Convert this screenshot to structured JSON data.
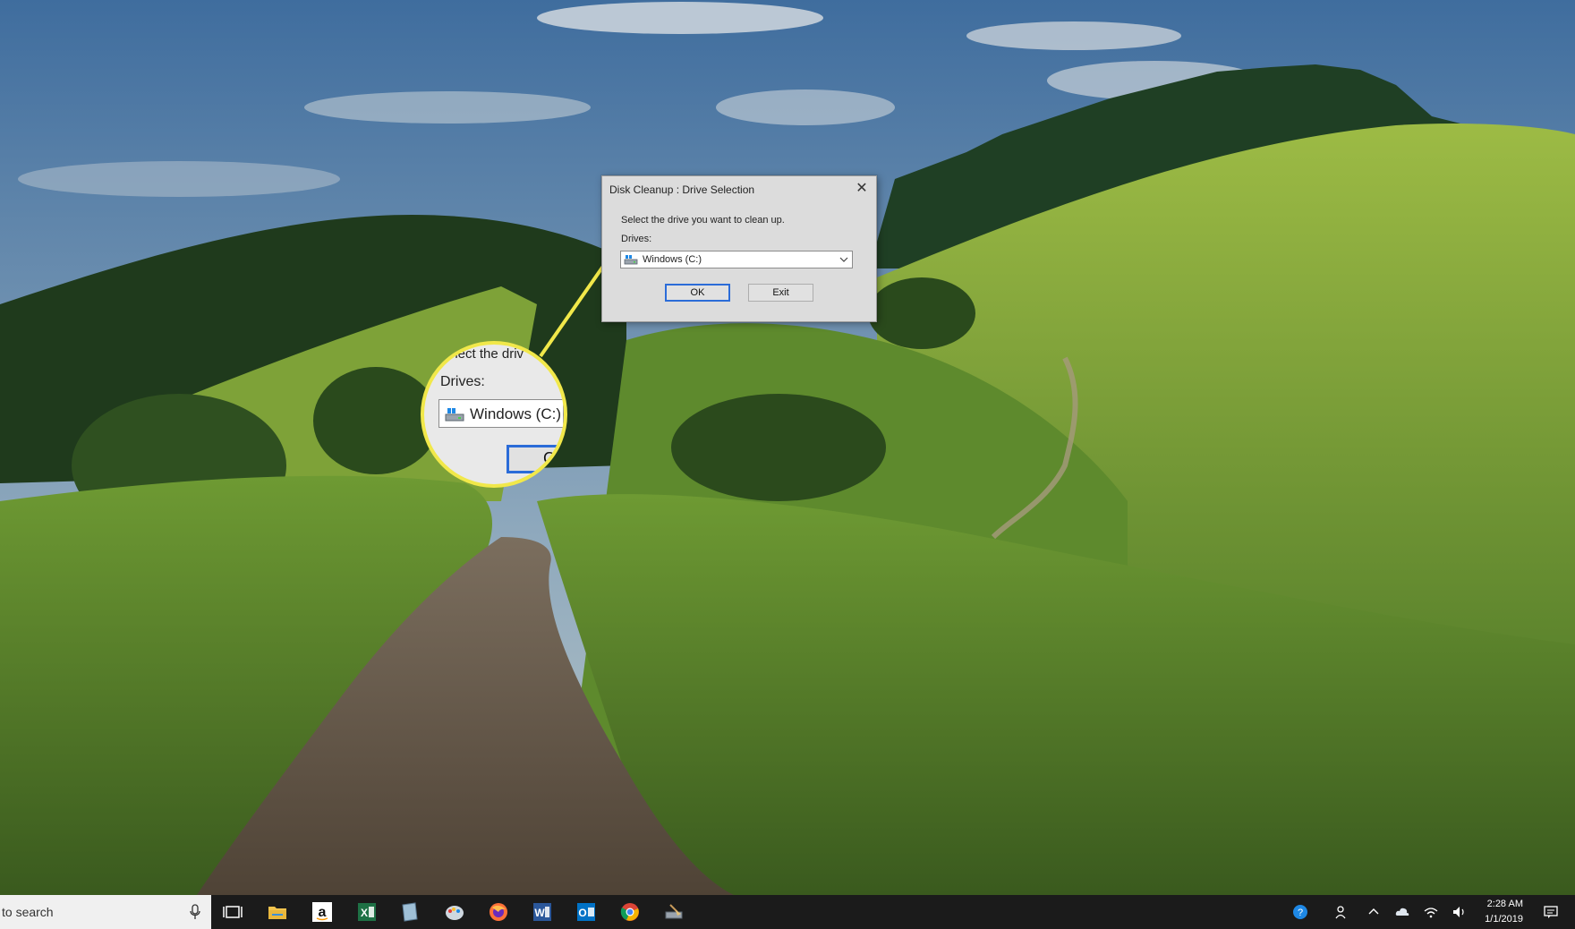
{
  "dialog": {
    "title": "Disk Cleanup : Drive Selection",
    "close_glyph": "✕",
    "message": "Select the drive you want to clean up.",
    "drives_label": "Drives:",
    "selected_drive": "Windows (C:)",
    "ok_label": "OK",
    "exit_label": "Exit"
  },
  "callout": {
    "partial_text": "elect the driv",
    "drives_label": "Drives:",
    "selected_drive": "Windows (C:)",
    "button_partial": "C",
    "highlight_color": "#f1e84a"
  },
  "taskbar": {
    "search_text": "to search",
    "pinned_icons": [
      "task-view-icon",
      "file-explorer-icon",
      "amazon-icon",
      "excel-icon",
      "notepad-icon",
      "paint-icon",
      "firefox-icon",
      "word-icon",
      "outlook-icon",
      "chrome-icon",
      "disk-cleanup-icon"
    ],
    "clock_time": "2:28 AM",
    "clock_date": "1/1/2019"
  },
  "colors": {
    "accent": "#2b6cd8",
    "taskbar_bg": "#1b1b1b"
  }
}
